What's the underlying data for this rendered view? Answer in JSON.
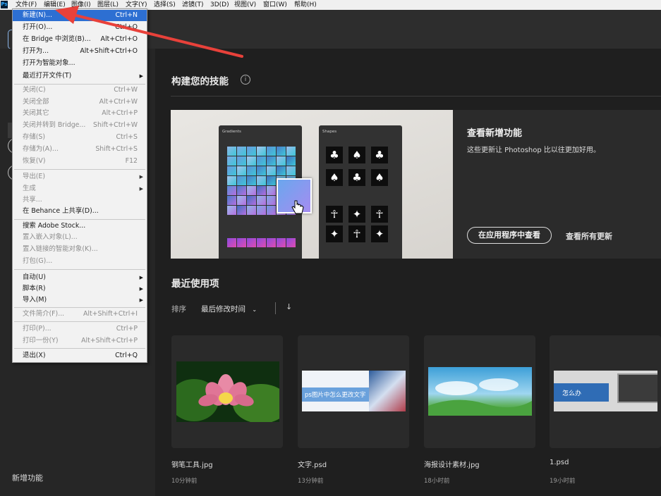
{
  "menubar": {
    "items": [
      "文件(F)",
      "编辑(E)",
      "图像(I)",
      "图层(L)",
      "文字(Y)",
      "选择(S)",
      "滤镜(T)",
      "3D(D)",
      "视图(V)",
      "窗口(W)",
      "帮助(H)"
    ]
  },
  "file_menu": {
    "items": [
      {
        "label": "新建(N)...",
        "shortcut": "Ctrl+N"
      },
      {
        "label": "打开(O)...",
        "shortcut": "Ctrl+O"
      },
      {
        "label": "在 Bridge 中浏览(B)...",
        "shortcut": "Alt+Ctrl+O"
      },
      {
        "label": "打开为...",
        "shortcut": "Alt+Shift+Ctrl+O"
      },
      {
        "label": "打开为智能对象...",
        "shortcut": ""
      },
      {
        "label": "最近打开文件(T)",
        "shortcut": ""
      },
      {
        "label": "关闭(C)",
        "shortcut": "Ctrl+W"
      },
      {
        "label": "关闭全部",
        "shortcut": "Alt+Ctrl+W"
      },
      {
        "label": "关闭其它",
        "shortcut": "Alt+Ctrl+P"
      },
      {
        "label": "关闭并转到 Bridge...",
        "shortcut": "Shift+Ctrl+W"
      },
      {
        "label": "存储(S)",
        "shortcut": "Ctrl+S"
      },
      {
        "label": "存储为(A)...",
        "shortcut": "Shift+Ctrl+S"
      },
      {
        "label": "恢复(V)",
        "shortcut": "F12"
      },
      {
        "label": "导出(E)",
        "shortcut": ""
      },
      {
        "label": "生成",
        "shortcut": ""
      },
      {
        "label": "共享...",
        "shortcut": ""
      },
      {
        "label": "在 Behance 上共享(D)...",
        "shortcut": ""
      },
      {
        "label": "搜索 Adobe Stock...",
        "shortcut": ""
      },
      {
        "label": "置入嵌入对象(L)...",
        "shortcut": ""
      },
      {
        "label": "置入链接的智能对象(K)...",
        "shortcut": ""
      },
      {
        "label": "打包(G)...",
        "shortcut": ""
      },
      {
        "label": "自动(U)",
        "shortcut": ""
      },
      {
        "label": "脚本(R)",
        "shortcut": ""
      },
      {
        "label": "导入(M)",
        "shortcut": ""
      },
      {
        "label": "文件简介(F)...",
        "shortcut": "Alt+Shift+Ctrl+I"
      },
      {
        "label": "打印(P)...",
        "shortcut": "Ctrl+P"
      },
      {
        "label": "打印一份(Y)",
        "shortcut": "Alt+Shift+Ctrl+P"
      },
      {
        "label": "退出(X)",
        "shortcut": "Ctrl+Q"
      }
    ]
  },
  "sidebar": {
    "whats_new": "新增功能"
  },
  "skills": {
    "title": "构建您的技能",
    "info_icon": "i",
    "banner": {
      "heading": "查看新增功能",
      "description": "这些更新让 Photoshop 比以往更加好用。",
      "view_in_app": "在应用程序中查看",
      "view_all_updates": "查看所有更新",
      "gradients_panel_title": "Gradients",
      "shapes_panel_title": "Shapes"
    }
  },
  "recent": {
    "title": "最近使用项",
    "sort_label": "排序",
    "sort_value": "最后修改时间",
    "sort_arrow": "↓",
    "files": [
      {
        "name": "钢笔工具.jpg",
        "time": "10分钟前"
      },
      {
        "name": "文字.psd",
        "time": "13分钟前",
        "thumb_text": "ps图片中怎么更改文字"
      },
      {
        "name": "海报设计素材.jpg",
        "time": "18小时前"
      },
      {
        "name": "1.psd",
        "time": "19小时前",
        "thumb_text": "怎么办"
      }
    ]
  },
  "colors": {
    "menu_highlight": "#2d6fd2",
    "annotation_arrow": "#e8413a",
    "background": "#1f1f1f"
  }
}
